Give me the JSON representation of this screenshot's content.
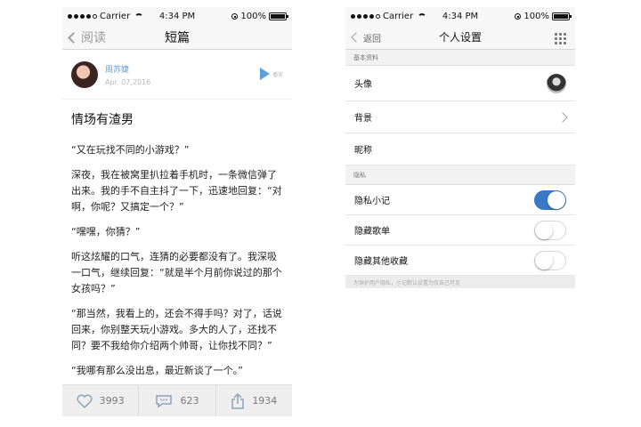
{
  "status": {
    "carrier": "Carrier",
    "time": "4:34 PM",
    "battery": "100%",
    "battery_level": 1.0
  },
  "reader": {
    "back_label": "阅读",
    "title": "短篇",
    "author_name": "周苏婕",
    "date": "Apr. 07,2016",
    "play_label": "播放",
    "article_title": "情场有渣男",
    "paragraphs": [
      "“又在玩找不同的小游戏？”",
      "深夜，我在被窝里扒拉着手机时，一条微信弹了出来。我的手不自主抖了一下，迅速地回复：“对啊，你呢？又搞定一个？”",
      "“嘿嘿，你猜？”",
      "听这炫耀的口气，连猜的必要都没有了。我深吸一口气，继续回复：“就是半个月前你说过的那个女孩吗？”",
      "“那当然，我看上的，还会不得手吗？对了，话说回来，你别整天玩小游戏。多大的人了，还找不同？要不我给你介绍两个帅哥，让你找不同？”",
      "“我哪有那么没出息，最近新谈了一个。”"
    ],
    "likes": "3993",
    "comments": "623",
    "shares": "1934"
  },
  "settings": {
    "back_label": "返回",
    "title": "个人设置",
    "section_basic": "基本资料",
    "row_avatar": "头像",
    "row_background": "背景",
    "row_nickname": "昵称",
    "section_privacy": "隐私",
    "row_private_note": "隐私小记",
    "private_note_on": true,
    "row_hide_songs": "隐藏歌单",
    "hide_songs_on": false,
    "row_hide_favs": "隐藏其他收藏",
    "hide_favs_on": false,
    "footer_note": "为保护用户隐私，小记默认设置为仅自己可见"
  },
  "colors": {
    "accent": "#3a79c7",
    "link": "#5aa0de"
  }
}
